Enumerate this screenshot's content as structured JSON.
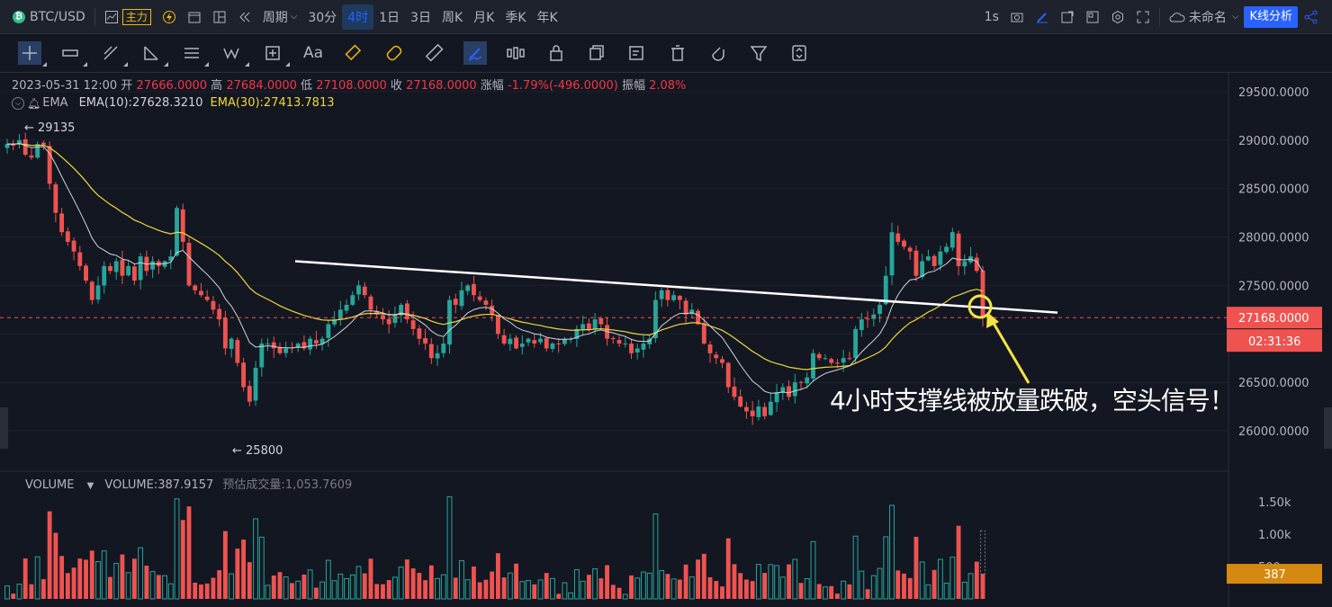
{
  "topbar": {
    "symbol": "BTC/USD",
    "indicator_main": "主力",
    "period_label": "周期",
    "intervals": [
      "30分",
      "4时",
      "1日",
      "3日",
      "周K",
      "月K",
      "季K",
      "年K"
    ],
    "active_interval": "4时",
    "refresh": "1s",
    "layout_name": "未命名",
    "kline_button": "K线分析"
  },
  "info": {
    "datetime": "2023-05-31 12:00",
    "open_label": "开",
    "open": "27666.0000",
    "high_label": "高",
    "high": "27684.0000",
    "low_label": "低",
    "low": "27108.0000",
    "close_label": "收",
    "close": "27168.0000",
    "change_label": "涨幅",
    "change": "-1.79%(-496.0000)",
    "amp_label": "振幅",
    "amp": "2.08%"
  },
  "ema": {
    "label": "EMA",
    "ema10": "EMA(10):27628.3210",
    "ema30": "EMA(30):27413.7813",
    "ema10_color": "#d1d4dc",
    "ema30_color": "#f0d83a"
  },
  "price_axis": {
    "ticks": [
      "29500.0000",
      "29000.0000",
      "28500.0000",
      "28000.0000",
      "27500.0000",
      "27000.0000",
      "26500.0000",
      "26000.0000"
    ],
    "current_price": "27168.0000",
    "countdown": "02:31:36"
  },
  "markers": {
    "high": "← 29135",
    "low": "← 25800"
  },
  "volume": {
    "label": "VOLUME",
    "value": "VOLUME:387.9157",
    "est_label": "预估成交量:",
    "est_value": "1,053.7609",
    "ticks": [
      "1.50k",
      "1.00k",
      "500"
    ],
    "current": "387"
  },
  "annotation": "4小时支撑线被放量跌破，空头信号！",
  "colors": {
    "up": "#26a69a",
    "down": "#ef5350",
    "bg": "#131722",
    "accent": "#2962ff"
  },
  "chart_data": {
    "type": "candlestick",
    "symbol": "BTC/USD",
    "interval": "4h",
    "ylim": [
      25800,
      29650
    ],
    "closes": [
      28960,
      28950,
      29000,
      28850,
      28820,
      28960,
      28950,
      28550,
      28250,
      28050,
      27950,
      27850,
      27700,
      27550,
      27350,
      27500,
      27700,
      27650,
      27750,
      27600,
      27700,
      27550,
      27800,
      27650,
      27750,
      27700,
      27750,
      27800,
      28300,
      27950,
      27500,
      27450,
      27400,
      27350,
      27250,
      27150,
      26850,
      26950,
      26700,
      26450,
      26300,
      26650,
      26900,
      26900,
      26850,
      26800,
      26850,
      26850,
      26900,
      26850,
      26950,
      26900,
      26950,
      27100,
      27150,
      27250,
      27300,
      27400,
      27500,
      27400,
      27250,
      27200,
      27150,
      27100,
      27200,
      27300,
      27150,
      27050,
      26950,
      26900,
      26750,
      26800,
      26900,
      27350,
      27300,
      27450,
      27500,
      27400,
      27350,
      27300,
      27200,
      27000,
      26900,
      26950,
      26850,
      26900,
      26950,
      26900,
      26950,
      26850,
      26900,
      26900,
      26950,
      26950,
      27050,
      27100,
      27050,
      27150,
      27100,
      26950,
      26950,
      26900,
      26900,
      26800,
      26850,
      26900,
      26950,
      27350,
      27450,
      27350,
      27400,
      27350,
      27200,
      27250,
      27100,
      26900,
      26800,
      26750,
      26700,
      26450,
      26350,
      26250,
      26200,
      26150,
      26250,
      26150,
      26300,
      26400,
      26450,
      26350,
      26500,
      26500,
      26550,
      26800,
      26750,
      26750,
      26700,
      26700,
      26750,
      26750,
      27050,
      27150,
      27150,
      27200,
      27300,
      27600,
      28050,
      27950,
      27900,
      27850,
      27600,
      27750,
      27800,
      27700,
      27850,
      27900,
      28050,
      27700,
      27750,
      27800,
      27650,
      27168
    ],
    "volume_ylim": [
      0,
      1600
    ],
    "current_volume": 387.9157,
    "estimated_volume": 1053.7609,
    "ema10_last": 27628.321,
    "ema30_last": 27413.7813,
    "resistance_line": {
      "start": 27750,
      "end": 27220
    }
  }
}
